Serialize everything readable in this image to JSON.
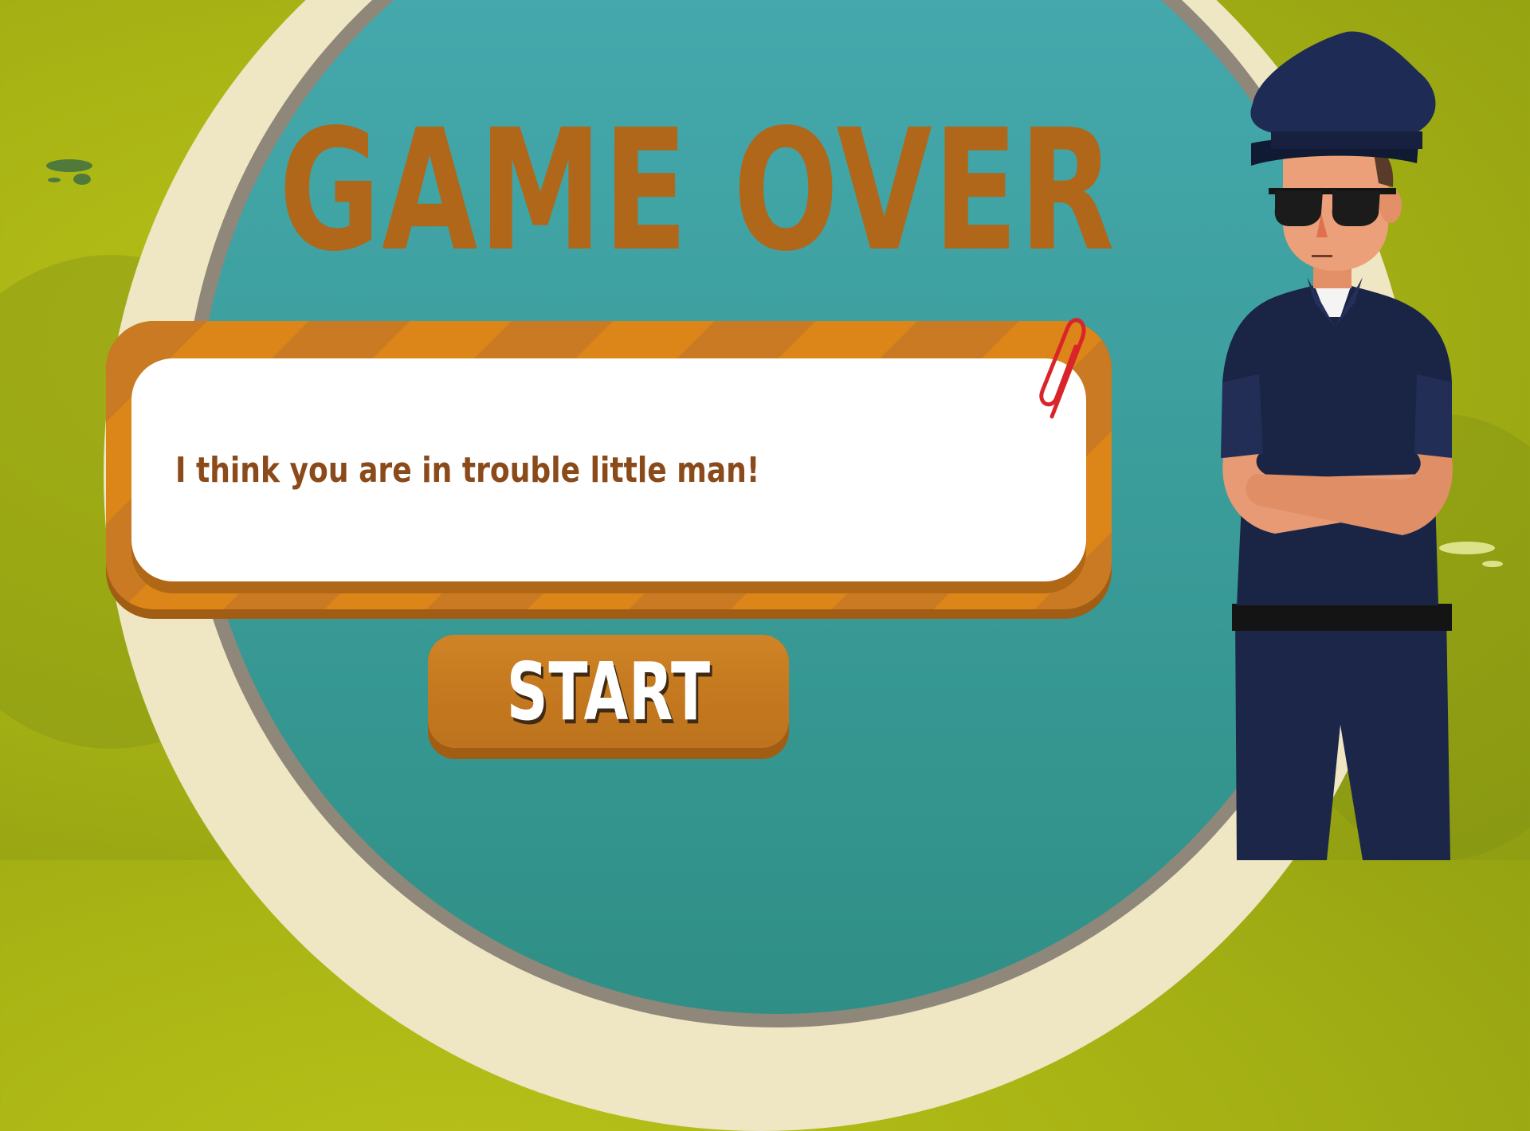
{
  "game": {
    "title": "GAME OVER",
    "message": "I think you are in trouble little man!",
    "start_label": "START"
  },
  "colors": {
    "background": "#a8b414",
    "ring_light": "#efe6c3",
    "ring_dark": "#8e877a",
    "circle": "#3c9e9c",
    "title": "#b0671a",
    "dialog_frame": "#c97a22",
    "dialog_text": "#8a4a1a",
    "button": "#c4781f",
    "paperclip": "#d9252a",
    "uniform": "#1a2546"
  },
  "icons": {
    "paperclip": "paperclip-icon",
    "character": "police-officer"
  }
}
